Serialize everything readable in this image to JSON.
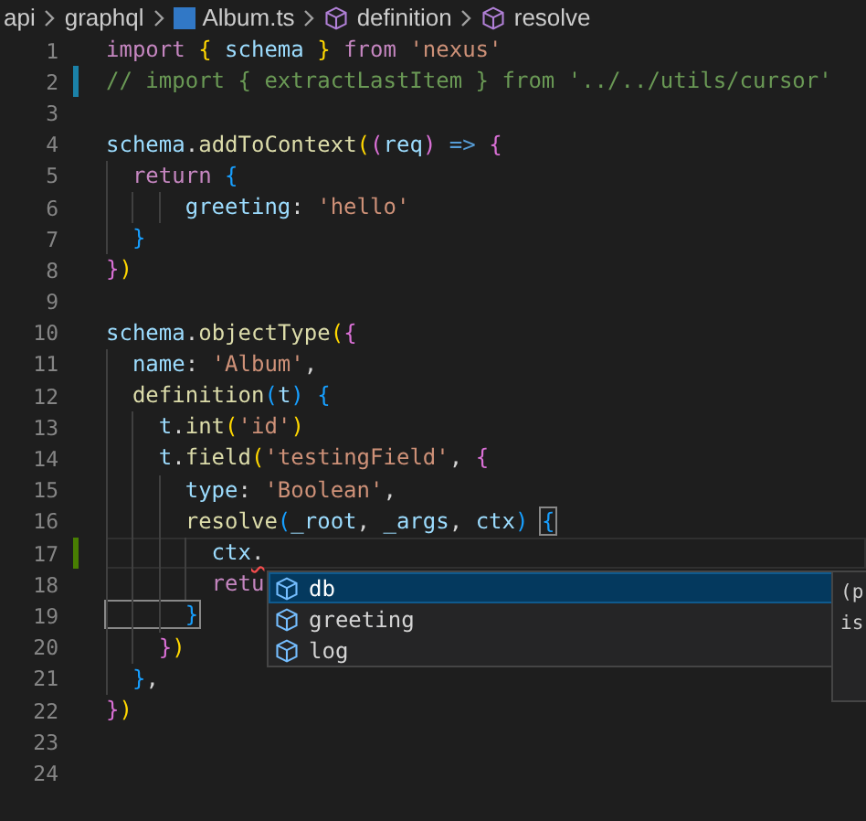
{
  "breadcrumb": [
    {
      "label": "api",
      "kind": "folder"
    },
    {
      "label": "graphql",
      "kind": "folder"
    },
    {
      "label": "Album.ts",
      "kind": "ts-file"
    },
    {
      "label": "definition",
      "kind": "symbol"
    },
    {
      "label": "resolve",
      "kind": "symbol"
    }
  ],
  "lines": [
    {
      "number": "1",
      "modified": false,
      "added": false,
      "current": false,
      "tokens": [
        {
          "text": "import ",
          "kind": "keyword"
        },
        {
          "text": "{ ",
          "kind": "bracket1"
        },
        {
          "text": "schema ",
          "kind": "variable"
        },
        {
          "text": "} ",
          "kind": "bracket1"
        },
        {
          "text": "from ",
          "kind": "keyword"
        },
        {
          "text": "'nexus'",
          "kind": "string"
        }
      ]
    },
    {
      "number": "2",
      "modified": true,
      "added": false,
      "current": false,
      "tokens": [
        {
          "text": "// import { extractLastItem } from '../../utils/cursor'",
          "kind": "comment"
        }
      ]
    },
    {
      "number": "3",
      "modified": false,
      "added": false,
      "current": false
    },
    {
      "number": "4",
      "modified": false,
      "added": false,
      "current": false,
      "tokens": [
        {
          "text": "schema",
          "kind": "variable"
        },
        {
          "text": "."
        },
        {
          "text": "addToContext",
          "kind": "function"
        },
        {
          "text": "(",
          "kind": "bracket1"
        },
        {
          "text": "(",
          "kind": "bracket2"
        },
        {
          "text": "req",
          "kind": "variable"
        },
        {
          "text": ") ",
          "kind": "bracket2"
        },
        {
          "text": "=> ",
          "kind": "arrow"
        },
        {
          "text": "{",
          "kind": "bracket2"
        }
      ]
    },
    {
      "number": "5",
      "modified": false,
      "added": false,
      "current": false,
      "tokens": [
        {
          "text": "  return ",
          "kind": "keyword"
        },
        {
          "text": "{",
          "kind": "bracket3"
        }
      ]
    },
    {
      "number": "6",
      "modified": false,
      "added": false,
      "current": false,
      "tokens": [
        {
          "text": "      greeting",
          "kind": "variable"
        },
        {
          "text": ": "
        },
        {
          "text": "'hello'",
          "kind": "string"
        }
      ]
    },
    {
      "number": "7",
      "modified": false,
      "added": false,
      "current": false,
      "tokens": [
        {
          "text": "  }",
          "kind": "bracket3"
        }
      ]
    },
    {
      "number": "8",
      "modified": false,
      "added": false,
      "current": false,
      "tokens": [
        {
          "text": "}",
          "kind": "bracket2"
        },
        {
          "text": ")",
          "kind": "bracket1"
        }
      ]
    },
    {
      "number": "9",
      "modified": false,
      "added": false,
      "current": false
    },
    {
      "number": "10",
      "modified": false,
      "added": false,
      "current": false,
      "tokens": [
        {
          "text": "schema",
          "kind": "variable"
        },
        {
          "text": "."
        },
        {
          "text": "objectType",
          "kind": "function"
        },
        {
          "text": "(",
          "kind": "bracket1"
        },
        {
          "text": "{",
          "kind": "bracket2"
        }
      ]
    },
    {
      "number": "11",
      "modified": false,
      "added": false,
      "current": false,
      "tokens": [
        {
          "text": "  name",
          "kind": "variable"
        },
        {
          "text": ": "
        },
        {
          "text": "'Album'",
          "kind": "string"
        },
        {
          "text": ","
        }
      ]
    },
    {
      "number": "12",
      "modified": false,
      "added": false,
      "current": false,
      "tokens": [
        {
          "text": "  definition",
          "kind": "function"
        },
        {
          "text": "(",
          "kind": "bracket3"
        },
        {
          "text": "t",
          "kind": "variable"
        },
        {
          "text": ") ",
          "kind": "bracket3"
        },
        {
          "text": "{",
          "kind": "bracket3"
        }
      ]
    },
    {
      "number": "13",
      "modified": false,
      "added": false,
      "current": false,
      "tokens": [
        {
          "text": "    t",
          "kind": "variable"
        },
        {
          "text": "."
        },
        {
          "text": "int",
          "kind": "function"
        },
        {
          "text": "(",
          "kind": "bracket1"
        },
        {
          "text": "'id'",
          "kind": "string"
        },
        {
          "text": ")",
          "kind": "bracket1"
        }
      ]
    },
    {
      "number": "14",
      "modified": false,
      "added": false,
      "current": false,
      "tokens": [
        {
          "text": "    t",
          "kind": "variable"
        },
        {
          "text": "."
        },
        {
          "text": "field",
          "kind": "function"
        },
        {
          "text": "(",
          "kind": "bracket1"
        },
        {
          "text": "'testingField'",
          "kind": "string"
        },
        {
          "text": ", "
        },
        {
          "text": "{",
          "kind": "bracket2"
        }
      ]
    },
    {
      "number": "15",
      "modified": false,
      "added": false,
      "current": false,
      "tokens": [
        {
          "text": "      type",
          "kind": "variable"
        },
        {
          "text": ": "
        },
        {
          "text": "'Boolean'",
          "kind": "string"
        },
        {
          "text": ","
        }
      ]
    },
    {
      "number": "16",
      "modified": false,
      "added": false,
      "current": false,
      "tokens": [
        {
          "text": "      resolve",
          "kind": "function"
        },
        {
          "text": "(",
          "kind": "bracket3"
        },
        {
          "text": "_root",
          "kind": "variable"
        },
        {
          "text": ", "
        },
        {
          "text": "_args",
          "kind": "variable"
        },
        {
          "text": ", "
        },
        {
          "text": "ctx",
          "kind": "variable"
        },
        {
          "text": ") ",
          "kind": "bracket3"
        },
        {
          "text": "{",
          "kind": "bracket3",
          "matched": true
        }
      ]
    },
    {
      "number": "17",
      "modified": false,
      "added": true,
      "current": true,
      "tokens": [
        {
          "text": "        ctx",
          "kind": "variable"
        },
        {
          "text": ".",
          "squiggle": true
        }
      ]
    },
    {
      "number": "18",
      "modified": false,
      "added": false,
      "current": false,
      "tokens": [
        {
          "text": "        retu",
          "kind": "keyword"
        }
      ]
    },
    {
      "number": "19",
      "modified": false,
      "added": false,
      "current": false,
      "tokens": [
        {
          "text": "      }",
          "kind": "bracket3",
          "matched": true
        }
      ]
    },
    {
      "number": "20",
      "modified": false,
      "added": false,
      "current": false,
      "tokens": [
        {
          "text": "    }",
          "kind": "bracket2"
        },
        {
          "text": ")",
          "kind": "bracket1"
        }
      ]
    },
    {
      "number": "21",
      "modified": false,
      "added": false,
      "current": false,
      "tokens": [
        {
          "text": "  }",
          "kind": "bracket3"
        },
        {
          "text": ","
        }
      ]
    },
    {
      "number": "22",
      "modified": false,
      "added": false,
      "current": false,
      "tokens": [
        {
          "text": "}",
          "kind": "bracket2"
        },
        {
          "text": ")",
          "kind": "bracket1"
        }
      ]
    },
    {
      "number": "23",
      "modified": false,
      "added": false,
      "current": false
    },
    {
      "number": "24",
      "modified": false,
      "added": false,
      "current": false
    }
  ],
  "suggestions": [
    {
      "label": "db",
      "selected": true
    },
    {
      "label": "greeting",
      "selected": false
    },
    {
      "label": "log",
      "selected": false
    }
  ],
  "details": [
    "(p",
    "is"
  ]
}
